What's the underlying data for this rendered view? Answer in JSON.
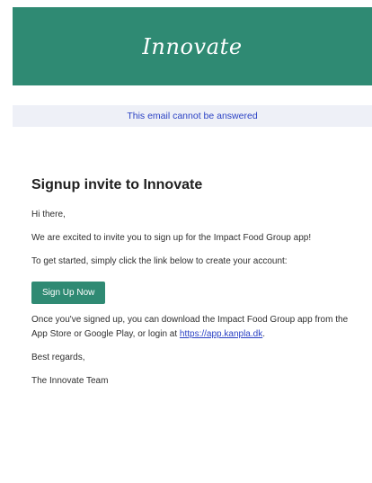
{
  "header": {
    "logo_text": "Innovate",
    "bg_color": "#2f8a73"
  },
  "notice": {
    "text": "This email cannot be answered"
  },
  "email": {
    "title": "Signup invite to Innovate",
    "greeting": "Hi there,",
    "intro": "We are excited to invite you to sign up for the Impact Food Group app!",
    "instruction": "To get started, simply click the link below to create your account:",
    "cta_label": "Sign Up Now",
    "after_signup_prefix": "Once you've signed up, you can download the Impact Food Group app from the App Store or Google Play, or login at",
    "login_link": "https://app.kanpla.dk",
    "after_signup_suffix": ".",
    "signoff": "Best regards,",
    "signature": "The Innovate Team"
  }
}
